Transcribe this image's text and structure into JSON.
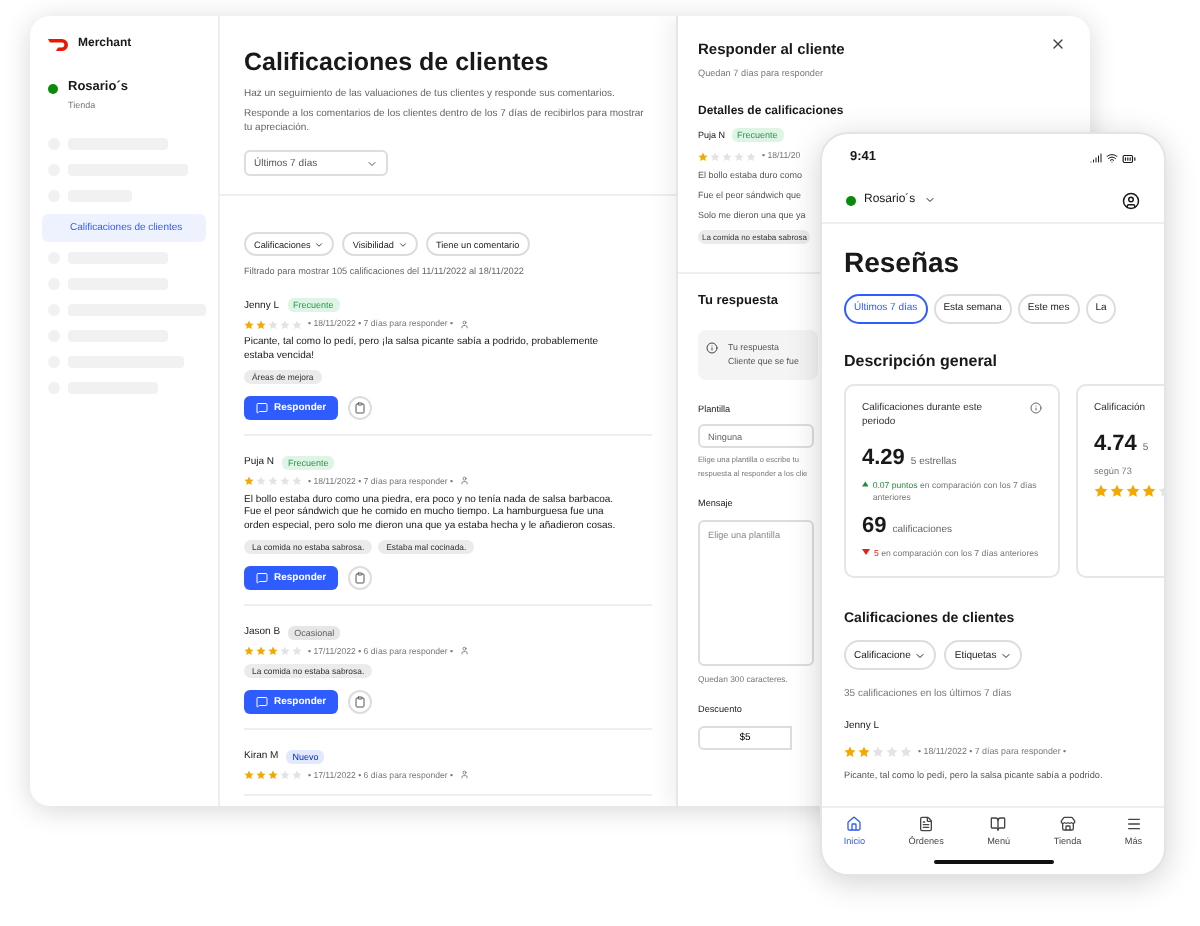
{
  "sidebar": {
    "brand": "Merchant",
    "store": {
      "name": "Rosario´s",
      "subtitle": "Tienda",
      "online": true
    },
    "items": [
      {
        "kind": "skeleton"
      },
      {
        "kind": "skeleton"
      },
      {
        "kind": "skeleton"
      },
      {
        "kind": "link",
        "label": "Calificaciones de clientes",
        "selected": true
      },
      {
        "kind": "skeleton"
      },
      {
        "kind": "skeleton"
      },
      {
        "kind": "skeleton"
      },
      {
        "kind": "skeleton"
      },
      {
        "kind": "skeleton"
      },
      {
        "kind": "skeleton"
      }
    ]
  },
  "main": {
    "title": "Calificaciones de clientes",
    "description": [
      "Haz un seguimiento de las valuaciones de tus clientes y responde sus comentarios.",
      "Responde a los comentarios de los clientes dentro de los 7 días de recibirlos para mostrar tu apreciación."
    ],
    "period": "Últimos 7 días",
    "filters": [
      {
        "label": "Calificaciones",
        "dropdown": true
      },
      {
        "label": "Visibilidad",
        "dropdown": true
      },
      {
        "label": "Tiene un comentario",
        "dropdown": false
      }
    ],
    "summary": "Filtrado para mostrar 105 calificaciones del 11/11/2022 al 18/11/2022",
    "reviews": [
      {
        "name": "Jenny L",
        "badge": "Frecuente",
        "color": "#def5e5",
        "stars": 2,
        "meta": "• 18/11/2022 • 7 días para responder •",
        "comment": "Picante, tal como lo pedí, pero ¡la salsa picante sabía a podrido, probablemente estaba vencida!",
        "tags": [
          "Áreas de mejora"
        ],
        "action": "Responder"
      },
      {
        "name": "Puja N",
        "badge": "Frecuente",
        "color": "#def5e5",
        "stars": 1,
        "meta": "• 18/11/2022 • 7 días para responder •",
        "comment": "El bollo estaba duro como una piedra, era poco y no tenía nada de salsa barbacoa. Fue el peor sándwich que he comido en mucho tiempo. La hamburguesa fue una orden especial, pero solo me dieron una que ya estaba hecha y le añadieron cosas.",
        "tags": [
          "La comida no estaba sabrosa.",
          "Estaba mal cocinada."
        ],
        "action": "Responder"
      },
      {
        "name": "Jason B",
        "badge": "Ocasional",
        "color": "#e6e6e6",
        "stars": 3,
        "meta": "• 17/11/2022 • 6 días para responder •",
        "tags": [
          "La comida no estaba sabrosa."
        ],
        "action": "Responder"
      },
      {
        "name": "Kiran M",
        "badge": "Nuevo",
        "color": "#e2e9ff",
        "stars": 3,
        "meta": "• 17/11/2022 • 6 días para responder •"
      }
    ]
  },
  "drawer": {
    "title": "Responder al cliente",
    "subtitle": "Quedan 7 días para responder",
    "details_title": "Detalles de calificaciones",
    "review": {
      "name": "Puja N",
      "badge": "Frecuente",
      "color": "#def5e5",
      "stars": 1,
      "meta": "• 18/11/20",
      "comment_lines": [
        "El bollo estaba duro como",
        "Fue el peor sándwich que",
        "Solo me dieron una que ya"
      ],
      "tag": "La comida no estaba sabrosa"
    },
    "response_title": "Tu respuesta",
    "info": [
      "Tu respuesta",
      "Cliente que se fue"
    ],
    "template_label": "Plantilla",
    "template_value": "Ninguna",
    "template_help": [
      "Elige una plantilla o escribe tu",
      "respuesta al responder a los clie"
    ],
    "message_label": "Mensaje",
    "message_placeholder": "Elige una plantilla",
    "remaining": "Quedan 300 caracteres.",
    "discount_label": "Descuento",
    "discounts": [
      "$5"
    ]
  },
  "phone": {
    "time": "9:41",
    "store": "Rosario´s",
    "online": true,
    "title": "Reseñas",
    "periods": [
      {
        "label": "Últimos 7 días",
        "selected": true
      },
      {
        "label": "Esta semana",
        "selected": false
      },
      {
        "label": "Este mes",
        "selected": false
      },
      {
        "label": "La",
        "selected": false
      }
    ],
    "overview_title": "Descripción general",
    "cards": [
      {
        "title": "Calificaciones durante este periodo",
        "value": "4.29",
        "unit": "5 estrellas",
        "trends": [
          {
            "kind": "up",
            "amount": "0.07 puntos",
            "text": "en comparación con los 7 días anteriores"
          },
          {
            "kind": "count",
            "amount": "69",
            "text": "calificaciones"
          },
          {
            "kind": "down",
            "amount": "5",
            "text": "en comparación con los 7 días anteriores"
          }
        ]
      },
      {
        "title": "Calificación",
        "value": "4.74",
        "unit": "5",
        "note": "según 73",
        "stars": 4
      }
    ],
    "reviews_title": "Calificaciones de clientes",
    "filters": [
      "Calificacione",
      "Etiquetas"
    ],
    "summary": "35 calificaciones en los últimos 7 días",
    "review": {
      "name": "Jenny L",
      "stars": 2,
      "meta": "• 18/11/2022 • 7 días para responder •",
      "comment": "Picante, tal como lo pedí, pero la salsa picante sabía a podrido."
    },
    "tabs": [
      {
        "label": "Inicio",
        "kind": "home",
        "selected": true
      },
      {
        "label": "Órdenes",
        "kind": "orders",
        "selected": false
      },
      {
        "label": "Menú",
        "kind": "menu",
        "selected": false
      },
      {
        "label": "Tienda",
        "kind": "store",
        "selected": false
      },
      {
        "label": "Más",
        "kind": "more",
        "selected": false
      }
    ]
  }
}
